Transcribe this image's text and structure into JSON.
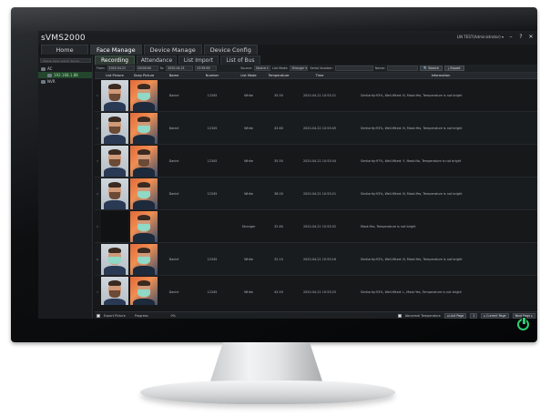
{
  "app": {
    "title": "sVMS2000",
    "user": "LIN  TEST(Administrator) ▾",
    "controls": [
      "–",
      "?",
      "✕"
    ]
  },
  "main_tabs": [
    {
      "label": "Home"
    },
    {
      "label": "Face Manage"
    },
    {
      "label": "Device Manage"
    },
    {
      "label": "Device Config"
    }
  ],
  "sidebar": {
    "search_placeholder": "Please input search device",
    "items": [
      {
        "label": "AC"
      },
      {
        "label": "192.168.1.88"
      },
      {
        "label": "NVR"
      }
    ]
  },
  "sub_tabs": [
    {
      "label": "Recording"
    },
    {
      "label": "Attendance"
    },
    {
      "label": "List Import"
    },
    {
      "label": "List of Bus"
    }
  ],
  "filters": {
    "from_label": "From:",
    "from_date": "2020-04-21",
    "from_time": "00:00:00",
    "to_label": "To:",
    "to_date": "2020-04-21",
    "to_time": "23:59:59",
    "source_label": "Source:",
    "source_value": "Device ▾",
    "list_mode_label": "List Mode:",
    "list_mode_value": "Stranger ▾",
    "serial_label": "Serial Number:",
    "name_label": "Name:",
    "search_button": "🔍 Search",
    "export_button": "⤓ Export"
  },
  "table": {
    "headers": [
      "List Picture",
      "Snap Picture",
      "Name",
      "Number",
      "List Mode",
      "Temperature",
      "Time",
      "Information"
    ],
    "rows": [
      {
        "no": "1",
        "name": "Daniel",
        "number": "12345",
        "mode": "White",
        "temp": "35.50",
        "time": "2020-04-21 10:53:21",
        "info": "Similarity:93%, Well-fitted: N, Mask:Yes, Temperature is not bright",
        "list_mask": false,
        "snap_mask": true
      },
      {
        "no": "2",
        "name": "Daniel",
        "number": "12345",
        "mode": "White",
        "temp": "43.60",
        "time": "2020-04-22 10:53:45",
        "info": "Similarity:93%, Well-fitted: N, Mask:Yes, Temperature is not bright",
        "list_mask": false,
        "snap_mask": true
      },
      {
        "no": "3",
        "name": "Daniel",
        "number": "12345",
        "mode": "White",
        "temp": "35.50",
        "time": "2020-04-21 10:53:04",
        "info": "Similarity:97%, Well-fitted: Y, Mask:No, Temperature is not bright",
        "list_mask": false,
        "snap_mask": false
      },
      {
        "no": "4",
        "name": "Daniel",
        "number": "12345",
        "mode": "White",
        "temp": "38.00",
        "time": "2020-04-21 10:53:21",
        "info": "Similarity:93%, Well-fitted: N, Mask:Yes, Temperature is not bright",
        "list_mask": false,
        "snap_mask": true
      },
      {
        "no": "5",
        "name": "",
        "number": "",
        "mode": "Stranger",
        "temp": "32.60",
        "time": "2020-04-21 10:53:02",
        "info": "Mask:Yes, Temperature is not bright",
        "list_mask": null,
        "snap_mask": true
      },
      {
        "no": "6",
        "name": "Daniel",
        "number": "12345",
        "mode": "White",
        "temp": "32.10",
        "time": "2020-04-21 10:53:16",
        "info": "Similarity:93%, Well-fitted: N, Mask:Yes, Temperature is not bright",
        "list_mask": true,
        "snap_mask": true
      },
      {
        "no": "7",
        "name": "Daniel",
        "number": "12345",
        "mode": "White",
        "temp": "43.50",
        "time": "2020-04-21 10:53:25",
        "info": "Similarity:93%, Well-fitted: L, Mask:Yes, Temperature is not bright",
        "list_mask": false,
        "snap_mask": true
      }
    ]
  },
  "footer": {
    "export_picture": "Export Picture",
    "progress_label": "Progress:",
    "progress_value": "0%",
    "abnormal_temp": "Abnormal Temperature",
    "last_page": "◂ Last Page",
    "page_input": "1",
    "current_page": "▸ Current Page",
    "next_page": "Next Page ▸"
  }
}
